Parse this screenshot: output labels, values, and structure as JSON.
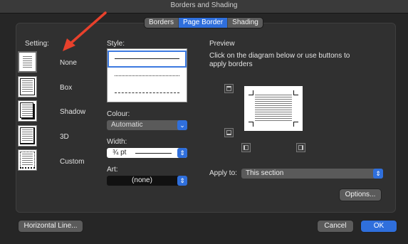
{
  "window": {
    "title": "Borders and Shading"
  },
  "tabs": [
    {
      "label": "Borders",
      "active": false
    },
    {
      "label": "Page Border",
      "active": true
    },
    {
      "label": "Shading",
      "active": false
    }
  ],
  "setting": {
    "label": "Setting:",
    "options": [
      {
        "label": "None",
        "selected": true
      },
      {
        "label": "Box",
        "selected": false
      },
      {
        "label": "Shadow",
        "selected": false
      },
      {
        "label": "3D",
        "selected": false
      },
      {
        "label": "Custom",
        "selected": false
      }
    ]
  },
  "style": {
    "label": "Style:",
    "options": [
      "solid",
      "dotted",
      "dashed"
    ],
    "selected": "solid"
  },
  "colour": {
    "label": "Colour:",
    "value": "Automatic"
  },
  "width": {
    "label": "Width:",
    "value": "¾ pt"
  },
  "art": {
    "label": "Art:",
    "value": "(none)"
  },
  "preview": {
    "label": "Preview",
    "instruction": "Click on the diagram below or use buttons to apply borders"
  },
  "apply_to": {
    "label": "Apply to:",
    "value": "This section"
  },
  "buttons": {
    "options": "Options...",
    "horizontal_line": "Horizontal Line...",
    "cancel": "Cancel",
    "ok": "OK"
  },
  "colors": {
    "accent": "#2f6fdc",
    "annotation_arrow": "#e8412c"
  }
}
